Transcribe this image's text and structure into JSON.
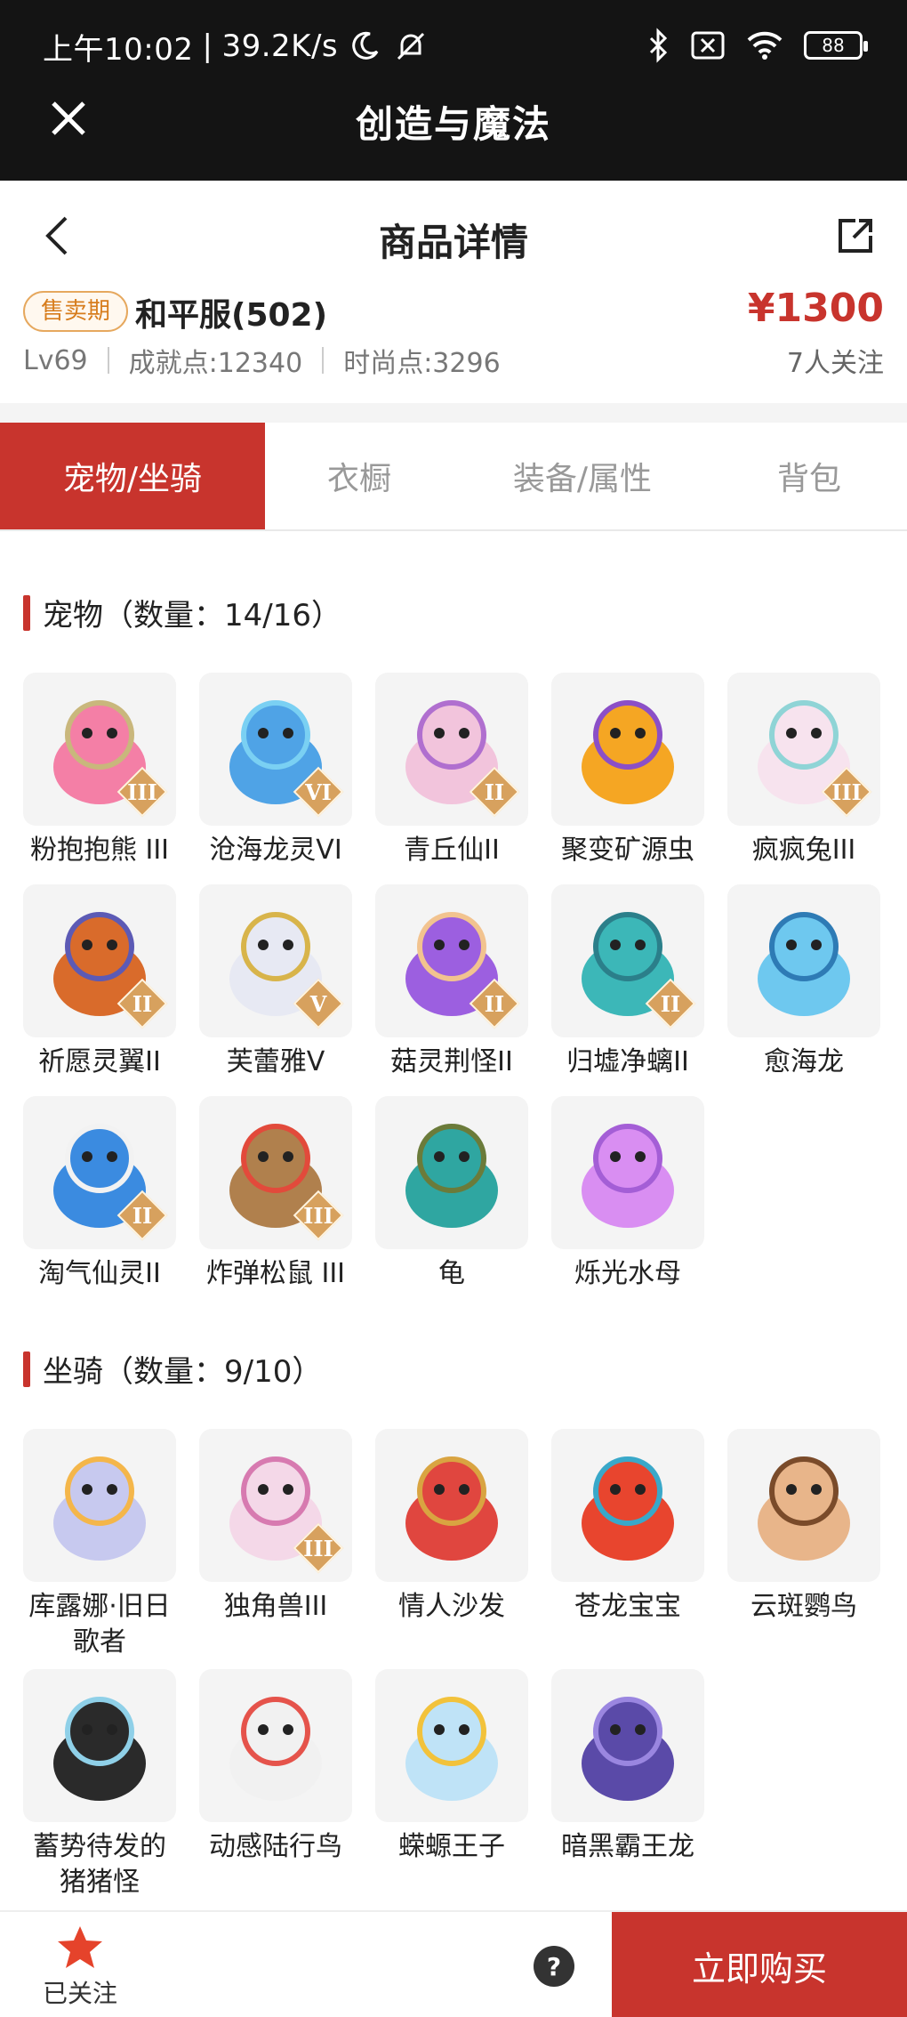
{
  "status_bar": {
    "time": "上午10:02",
    "speed": "39.2K/s",
    "battery": "88"
  },
  "app_bar": {
    "title": "创造与魔法"
  },
  "page_header": {
    "title": "商品详情"
  },
  "product": {
    "badge": "售卖期",
    "server": "和平服(502)",
    "price": "¥1300",
    "level": "Lv69",
    "achievement": "成就点:12340",
    "fashion": "时尚点:3296",
    "followers": "7人关注"
  },
  "tabs": [
    {
      "label": "宠物/坐骑",
      "active": true
    },
    {
      "label": "衣橱",
      "active": false
    },
    {
      "label": "装备/属性",
      "active": false
    },
    {
      "label": "背包",
      "active": false
    }
  ],
  "pets": {
    "title": "宠物（数量：14/16）",
    "items": [
      {
        "name": "粉抱抱熊 III",
        "tier": "III",
        "color": "#f47fa6",
        "accent": "#c9b77c"
      },
      {
        "name": "沧海龙灵VI",
        "tier": "VI",
        "color": "#4fa3e6",
        "accent": "#7ad0f3"
      },
      {
        "name": "青丘仙II",
        "tier": "II",
        "color": "#f2c4dc",
        "accent": "#b06fcf"
      },
      {
        "name": "聚变矿源虫",
        "tier": "",
        "color": "#f5a623",
        "accent": "#8b4fc7"
      },
      {
        "name": "疯疯兔III",
        "tier": "III",
        "color": "#f7e3ee",
        "accent": "#8fd4d6"
      },
      {
        "name": "祈愿灵翼II",
        "tier": "II",
        "color": "#d96b2b",
        "accent": "#5c5ab5"
      },
      {
        "name": "芙蕾雅V",
        "tier": "V",
        "color": "#e7e9f3",
        "accent": "#d8b44a"
      },
      {
        "name": "菇灵荆怪II",
        "tier": "II",
        "color": "#9c5fe0",
        "accent": "#f2c38f"
      },
      {
        "name": "归墟净螭II",
        "tier": "II",
        "color": "#3cb7b8",
        "accent": "#2b7f8a"
      },
      {
        "name": "愈海龙",
        "tier": "",
        "color": "#6ec8ef",
        "accent": "#2e7bb5"
      },
      {
        "name": "淘气仙灵II",
        "tier": "II",
        "color": "#3b8be0",
        "accent": "#f2f2f2"
      },
      {
        "name": "炸弹松鼠 III",
        "tier": "III",
        "color": "#b0804d",
        "accent": "#e24a3b"
      },
      {
        "name": "龟",
        "tier": "",
        "color": "#2fa6a1",
        "accent": "#6b7b3a"
      },
      {
        "name": "烁光水母",
        "tier": "",
        "color": "#d98ef2",
        "accent": "#a45ed6"
      }
    ]
  },
  "mounts": {
    "title": "坐骑（数量：9/10）",
    "items": [
      {
        "name": "库露娜·旧日\n歌者",
        "tier": "",
        "color": "#c7c9ef",
        "accent": "#f4b64a"
      },
      {
        "name": "独角兽III",
        "tier": "III",
        "color": "#f4d8e8",
        "accent": "#d77ab0"
      },
      {
        "name": "情人沙发",
        "tier": "",
        "color": "#e0463f",
        "accent": "#d9a441"
      },
      {
        "name": "苍龙宝宝",
        "tier": "",
        "color": "#e8452e",
        "accent": "#39a8c9"
      },
      {
        "name": "云斑鹦鸟",
        "tier": "",
        "color": "#e8b58a",
        "accent": "#7a4b2a"
      },
      {
        "name": "蓄势待发的\n猪猪怪",
        "tier": "",
        "color": "#2a2a2a",
        "accent": "#8fd0e8"
      },
      {
        "name": "动感陆行鸟",
        "tier": "",
        "color": "#f1f1f1",
        "accent": "#e5534b"
      },
      {
        "name": "蝾螈王子",
        "tier": "",
        "color": "#bfe3f7",
        "accent": "#f2c23b"
      },
      {
        "name": "暗黑霸王龙",
        "tier": "",
        "color": "#5a4aa8",
        "accent": "#9a86e0"
      }
    ]
  },
  "bottom_bar": {
    "follow_label": "已关注",
    "help_label": "?",
    "buy_label": "立即购买"
  },
  "colors": {
    "brand": "#c8342d",
    "badge": "#d77d1d",
    "tier_badge": "#d7a15e"
  },
  "icons": [
    "close-icon",
    "back-arrow-icon",
    "share-icon",
    "star-icon",
    "help-icon",
    "bluetooth-icon",
    "wifi-icon",
    "moon-icon",
    "mute-bell-icon",
    "battery-icon"
  ]
}
